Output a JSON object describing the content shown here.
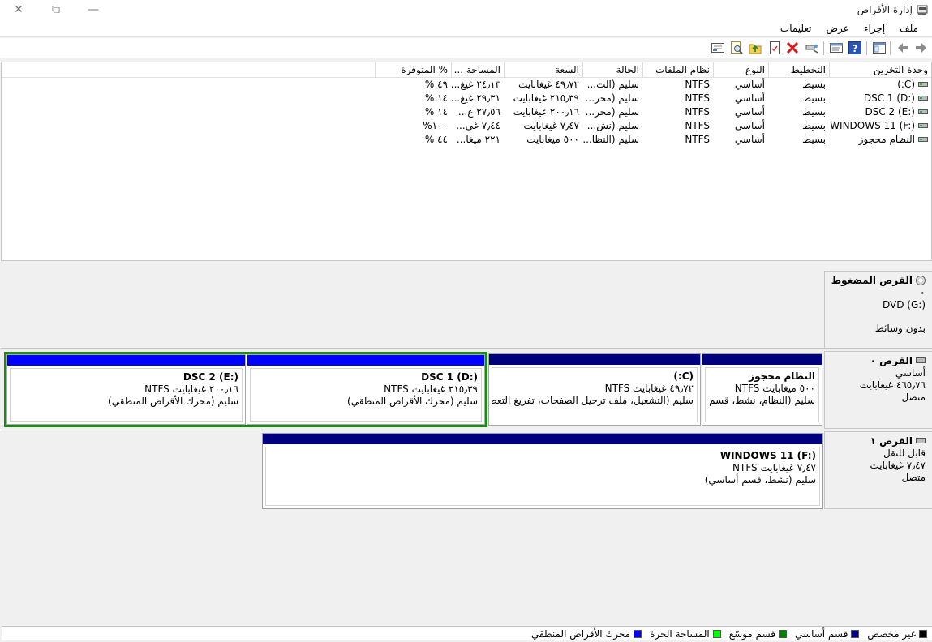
{
  "window": {
    "title": "إدارة الأقراص"
  },
  "menu": {
    "items": [
      "ملف",
      "إجراء",
      "عرض",
      "تعليمات"
    ]
  },
  "toolbar": {
    "icons": [
      "back-arrow-icon",
      "forward-arrow-icon",
      "console-tree-icon",
      "help-icon",
      "properties-icon",
      "connect-icon",
      "delete-icon",
      "checklist-icon",
      "up-folder-icon",
      "search-icon",
      "export-icon"
    ]
  },
  "volumes": {
    "columns": [
      "وحدة التخزين",
      "التخطيط",
      "النوع",
      "نظام الملفات",
      "الحالة",
      "السعة",
      "المساحة ...",
      "% المتوفرة"
    ],
    "rows": [
      [
        "(C:)",
        "بسيط",
        "أساسي",
        "NTFS",
        "سليم (الت...",
        "٤٩٫٧٢ غيغابايت",
        "٢٤٫١٣ غيغ...",
        "٤٩ %"
      ],
      [
        "DSC 1 (D:)",
        "بسيط",
        "أساسي",
        "NTFS",
        "سليم (محر...",
        "٢١٥٫٣٩ غيغابايت",
        "٢٩٫٣١ غيغ...",
        "١٤ %"
      ],
      [
        "DSC 2 (E:)",
        "بسيط",
        "أساسي",
        "NTFS",
        "سليم (محر...",
        "٢٠٠٫١٦ غيغابايت",
        "٢٧٫٥٦ غ...",
        "١٤ %"
      ],
      [
        "WINDOWS 11 (F:)",
        "بسيط",
        "أساسي",
        "NTFS",
        "سليم (نش...",
        "٧٫٤٧ غيغابايت",
        "٧٫٤٤ غي...",
        "١٠٠%"
      ],
      [
        "النظام محجوز",
        "بسيط",
        "أساسي",
        "NTFS",
        "سليم (النظا...",
        "٥٠٠ ميغابايت",
        "٢٢١ ميغا...",
        "٤٤ %"
      ]
    ]
  },
  "disks": {
    "cdrom": {
      "name": "القرص المضغوط ٠",
      "drive": "DVD (G:)",
      "status": "بدون وسائط"
    },
    "disk0": {
      "name": "القرص ٠",
      "type": "أساسي",
      "size": "٤٦٥٫٧٦ غيغابايت",
      "state": "متصل",
      "partitions": [
        {
          "title": "النظام محجوز",
          "size": "٥٠٠ ميغابايت NTFS",
          "status": "سليم (النظام، نشط، قسم أساسي)"
        },
        {
          "title": "(C:)",
          "size": "٤٩٫٧٢ غيغابايت NTFS",
          "status": "سليم (التشغيل، ملف ترحيل الصفحات، تفريغ التعطل، قسم أساسي)"
        },
        {
          "title": "DSC 1  (D:)",
          "size": "٢١٥٫٣٩ غيغابايت NTFS",
          "status": "سليم (محرك الأقراص المنطقي)"
        },
        {
          "title": "DSC 2  (E:)",
          "size": "٢٠٠٫١٦ غيغابايت NTFS",
          "status": "سليم (محرك الأقراص المنطقي)"
        }
      ]
    },
    "disk1": {
      "name": "القرص ١",
      "type": "قابل للنقل",
      "size": "٧٫٤٧ غيغابايت",
      "state": "متصل",
      "partitions": [
        {
          "title": "WINDOWS 11   (F:)",
          "size": "٧٫٤٧ غيغابايت NTFS",
          "status": "سليم (نشط، قسم أساسي)"
        }
      ]
    }
  },
  "colors": {
    "primary_bar": "#00007f",
    "logical_bar": "#0000ff",
    "selected_border": "#1b8a1b"
  },
  "legend": [
    {
      "label": "غير مخصص",
      "color": "#000000"
    },
    {
      "label": "قسم أساسي",
      "color": "#00007f"
    },
    {
      "label": "قسم موسّع",
      "color": "#008000"
    },
    {
      "label": "المساحة الحرة",
      "color": "#00ff00"
    },
    {
      "label": "محرك الأقراص المنطقي",
      "color": "#0000ff"
    }
  ]
}
